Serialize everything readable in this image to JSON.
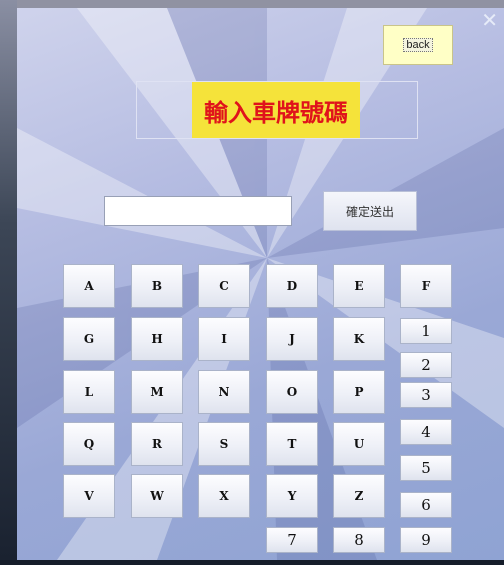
{
  "window": {
    "close_symbol": "✕"
  },
  "back_button": {
    "label": "back"
  },
  "title": {
    "text": "輸入車牌號碼"
  },
  "plate_input": {
    "value": "",
    "placeholder": ""
  },
  "submit_button": {
    "label": "確定送出"
  },
  "keypad": {
    "letters": [
      "A",
      "B",
      "C",
      "D",
      "E",
      "G",
      "H",
      "I",
      "J",
      "K",
      "L",
      "M",
      "N",
      "O",
      "P",
      "Q",
      "R",
      "S",
      "T",
      "U",
      "V",
      "W",
      "X",
      "Y",
      "Z",
      "F"
    ],
    "numbers": [
      "1",
      "2",
      "3",
      "4",
      "5",
      "6",
      "7",
      "8",
      "9"
    ]
  },
  "colors": {
    "title_bg": "#f5e33a",
    "title_text": "#e0131b",
    "back_bg": "#ffffc6"
  }
}
